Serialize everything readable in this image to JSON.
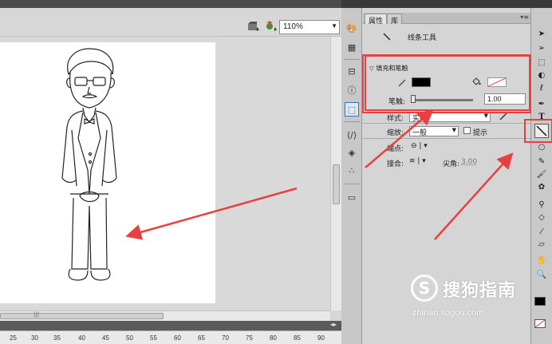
{
  "stage": {
    "zoom": "110%",
    "ruler_ticks": [
      "25",
      "30",
      "35",
      "40",
      "45",
      "50",
      "55",
      "60",
      "65",
      "70",
      "75",
      "80",
      "85",
      "90"
    ]
  },
  "properties_panel": {
    "tabs": [
      {
        "label": "属性",
        "active": true
      },
      {
        "label": "库",
        "active": false
      }
    ],
    "tool_name": "线条工具",
    "fill_stroke": {
      "section_title": "填充和笔触",
      "stroke_color": "#000000",
      "fill_color": "none",
      "stroke_label": "笔触:",
      "stroke_value": "1.00"
    },
    "style": {
      "label": "样式:",
      "value": "实线"
    },
    "scale": {
      "label": "缩放:",
      "value": "一般",
      "hint_label": "提示"
    },
    "cap": {
      "label": "端点:"
    },
    "join": {
      "label": "接合:",
      "miter_label": "尖角:",
      "miter_value": "3.00"
    }
  },
  "icons": {
    "dock": [
      "paint-palette-icon",
      "grid-icon",
      "align-icon",
      "info-icon",
      "transform-icon",
      "code-icon",
      "components-icon",
      "motion-icon",
      "library-icon"
    ],
    "toolbox": [
      "selection-tool-icon",
      "subselection-tool-icon",
      "free-transform-icon",
      "3d-rotation-icon",
      "lasso-icon",
      "pen-icon",
      "text-icon",
      "line-tool-icon",
      "oval-tool-icon",
      "pencil-icon",
      "brush-icon",
      "deco-icon",
      "bone-icon",
      "paint-bucket-icon",
      "eyedropper-icon",
      "eraser-icon",
      "hand-icon",
      "zoom-icon",
      "stroke-color-icon",
      "fill-color-icon"
    ]
  },
  "colors": {
    "highlight": "#e84040",
    "panel_bg": "#d5d5d5",
    "stage_bg": "#ffffff"
  },
  "watermark": {
    "logo": "S",
    "brand": "搜狗指南",
    "url": "zhinan.sogou.com"
  }
}
